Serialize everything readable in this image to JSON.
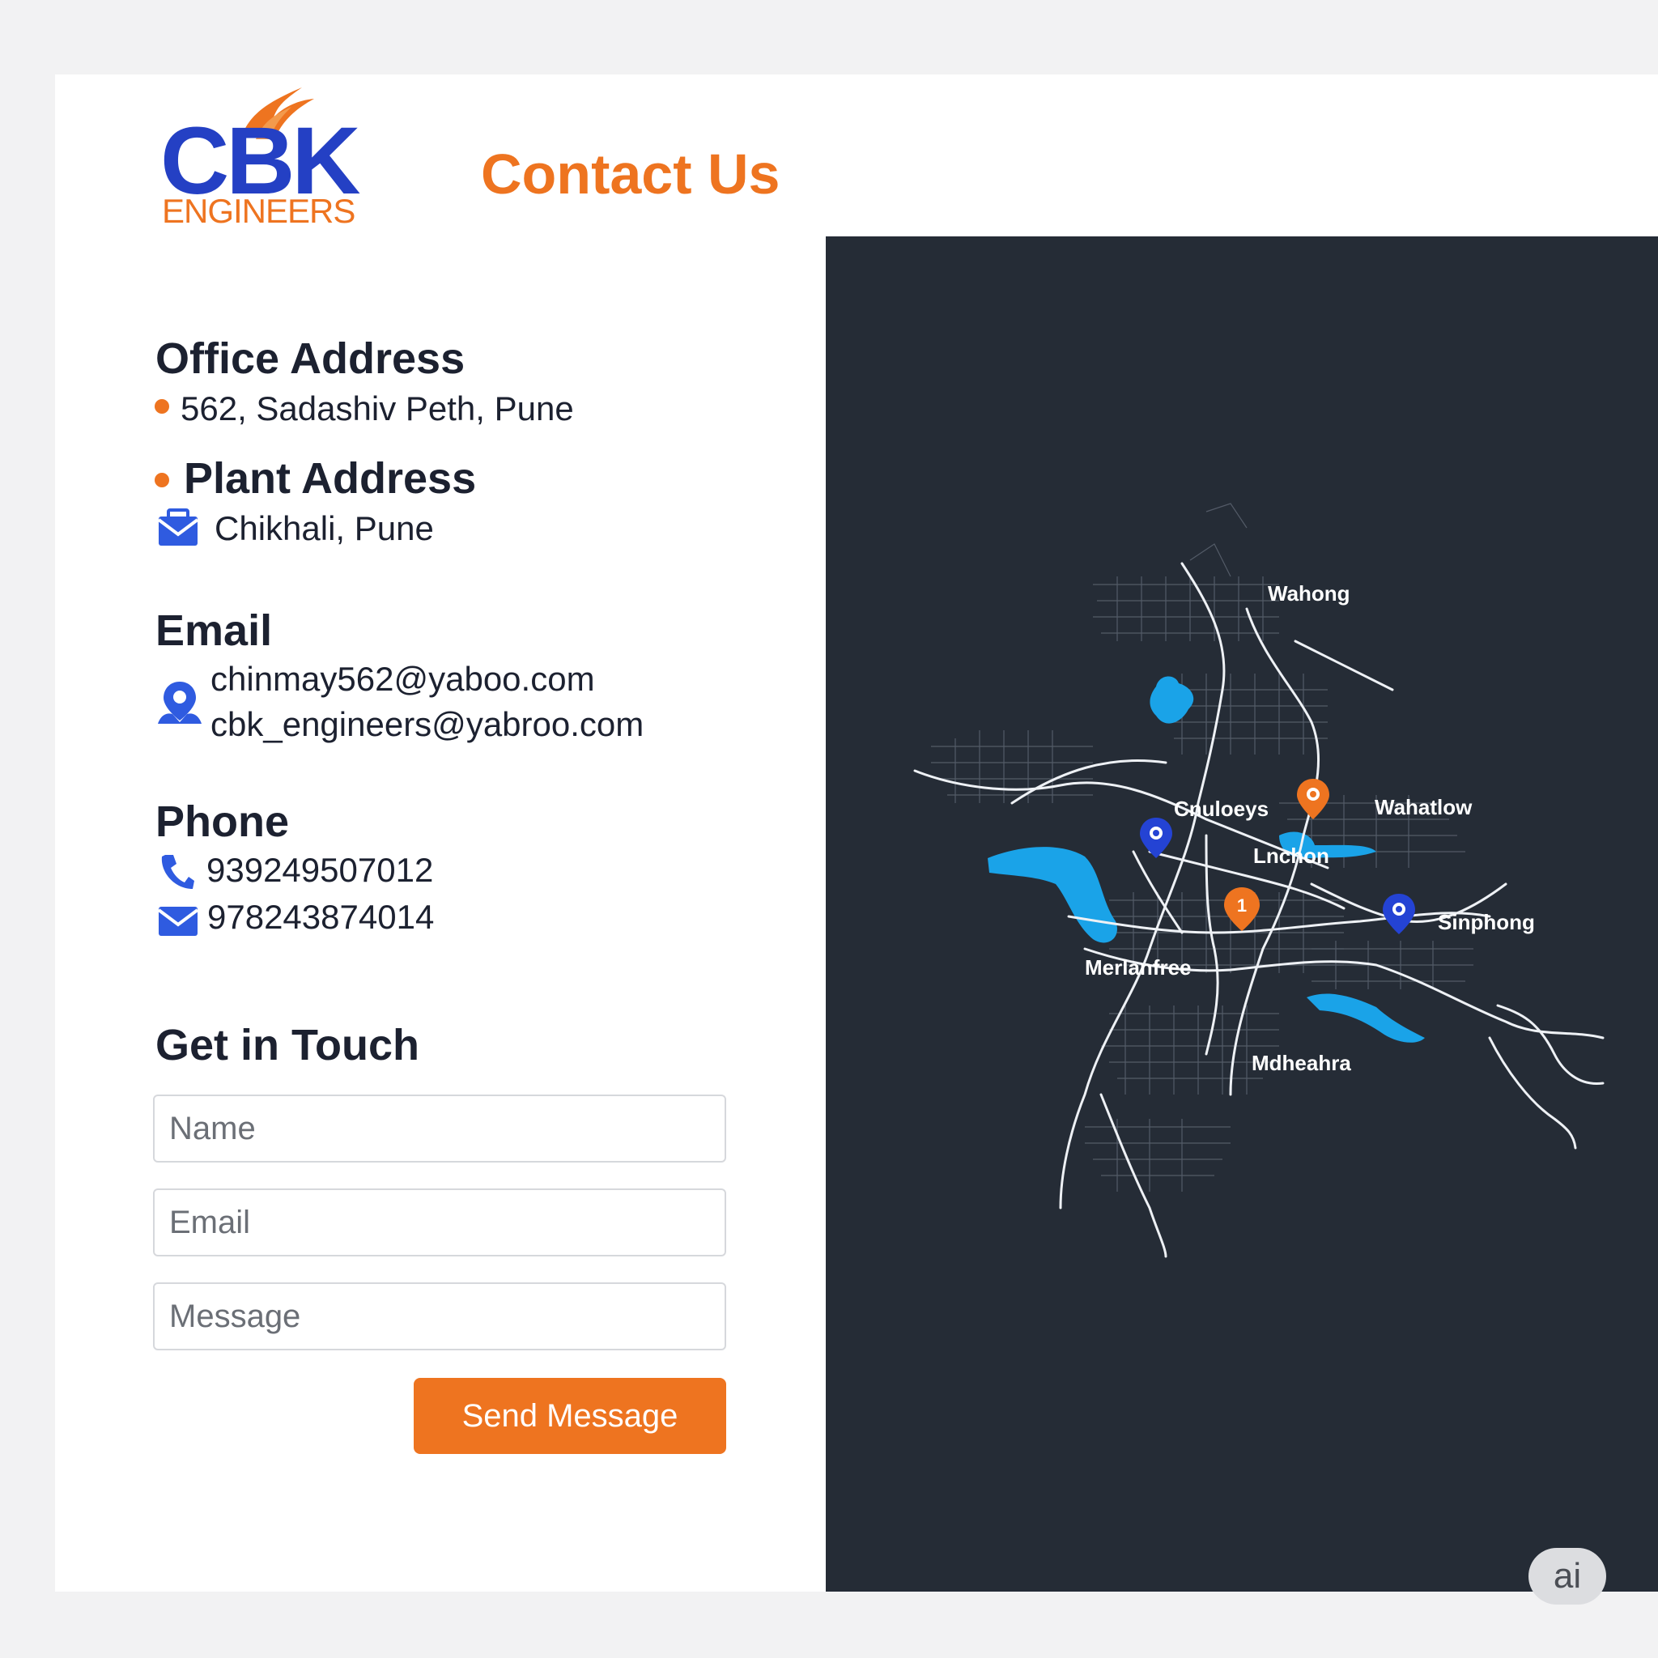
{
  "brand": {
    "logo_main": "CBK",
    "logo_sub": "ENGINEERS",
    "primary_color": "#2440c4",
    "accent_color": "#ee7420"
  },
  "page": {
    "title": "Contact Us"
  },
  "office": {
    "heading": "Office Address",
    "value": "562, Sadashiv Peth, Pune"
  },
  "plant": {
    "heading": "Plant Address",
    "value": "Chikhali, Pune"
  },
  "email": {
    "heading": "Email",
    "values": [
      "chinmay562@yaboo.com",
      "cbk_engineers@yabroo.com"
    ]
  },
  "phone": {
    "heading": "Phone",
    "values": [
      "939249507012",
      "978243874014"
    ]
  },
  "form": {
    "heading": "Get in Touch",
    "name_placeholder": "Name",
    "email_placeholder": "Email",
    "message_placeholder": "Message",
    "submit_label": "Send Message"
  },
  "map": {
    "background_color": "#252c36",
    "water_color": "#1aa3e8",
    "labels": [
      "Wahong",
      "Wahatlow",
      "Cnuloeys",
      "Lnchon",
      "Sinphong",
      "Merlanfree",
      "Mdheahra"
    ],
    "markers": [
      {
        "color": "blue",
        "icon": "location-pin-icon"
      },
      {
        "color": "orange",
        "icon": "location-pin-icon"
      },
      {
        "color": "orange",
        "icon": "numbered-pin-icon",
        "number": "1"
      },
      {
        "color": "blue",
        "icon": "location-pin-icon"
      }
    ]
  },
  "badge": {
    "label": "ai"
  }
}
